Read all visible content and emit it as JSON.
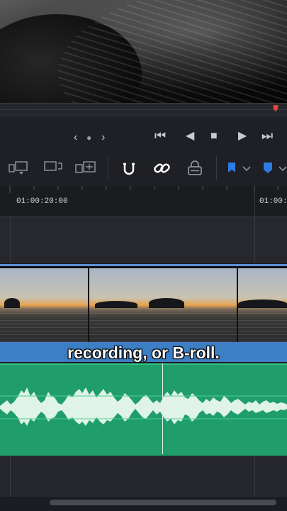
{
  "transport": {
    "clip_prev": "‹",
    "clip_next": "›",
    "dot": "●",
    "jump_start": "⏮",
    "play_reverse": "◀",
    "stop": "■",
    "play": "▶",
    "jump_end": "⏭"
  },
  "ruler": {
    "timecodes": [
      "01:00:20:00",
      "01:00:2"
    ]
  },
  "subtitle": {
    "text": "recording, or B-roll."
  },
  "colors": {
    "accent_blue": "#2f7be6",
    "subtitle_track": "#3d7fc4",
    "audio_track": "#1f9e6c",
    "playhead": "#e0453c"
  },
  "icons": {
    "toolbar": [
      "edit-overwrite-icon",
      "replace-icon",
      "fit-to-fill-icon",
      "snapping-icon",
      "link-icon",
      "position-lock-icon",
      "flag-icon",
      "marker-icon"
    ]
  }
}
